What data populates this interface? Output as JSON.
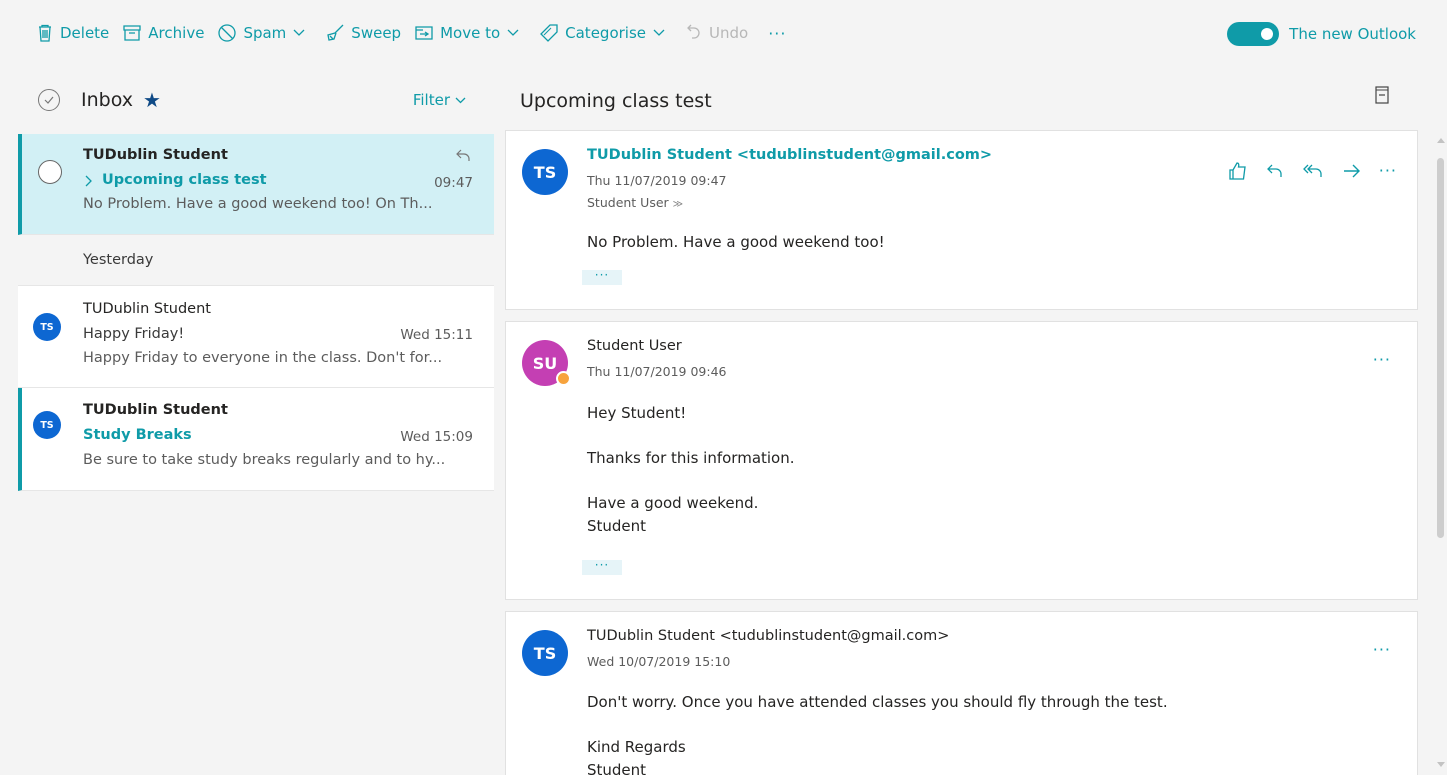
{
  "toolbar": {
    "delete": "Delete",
    "archive": "Archive",
    "spam": "Spam",
    "sweep": "Sweep",
    "move_to": "Move to",
    "categorise": "Categorise",
    "undo": "Undo",
    "more": "···",
    "new_outlook_label": "The new Outlook",
    "new_outlook_enabled": true
  },
  "list": {
    "folder_title": "Inbox",
    "favorite_icon": "star-icon",
    "filter_label": "Filter",
    "group_yesterday": "Yesterday",
    "messages": [
      {
        "sender": "TUDublin Student",
        "subject": "Upcoming class test",
        "time": "09:47",
        "preview": "No Problem. Have a good weekend too! On Th...",
        "selected": true,
        "unread": true,
        "replied": true
      },
      {
        "sender": "TUDublin Student",
        "subject": "Happy Friday!",
        "time": "Wed 15:11",
        "preview": "Happy Friday to everyone in the class. Don't for...",
        "initials": "TS",
        "unread": false
      },
      {
        "sender": "TUDublin Student",
        "subject": "Study Breaks",
        "time": "Wed 15:09",
        "preview": "Be sure to take study breaks regularly and to hy...",
        "initials": "TS",
        "unread": true
      }
    ]
  },
  "reading": {
    "title": "Upcoming class test",
    "messages": [
      {
        "initials": "TS",
        "avatar_color": "#0d67d2",
        "from": "TUDublin Student <tudublinstudent@gmail.com>",
        "date": "Thu 11/07/2019 09:47",
        "to": "Student User",
        "body": [
          "No Problem. Have a good weekend too!"
        ],
        "expand": "···",
        "more": "···"
      },
      {
        "initials": "SU",
        "avatar_color": "#c43fb3",
        "from": "Student User",
        "date": "Thu 11/07/2019 09:46",
        "body": [
          "Hey Student!",
          "Thanks for this information.",
          "Have a good weekend.",
          "Student"
        ],
        "expand": "···",
        "more": "···"
      },
      {
        "initials": "TS",
        "avatar_color": "#0d67d2",
        "from": "TUDublin Student <tudublinstudent@gmail.com>",
        "date": "Wed 10/07/2019 15:10",
        "body": [
          "Don't worry. Once you have attended classes you should fly through the test.",
          "Kind Regards",
          "Student"
        ],
        "more": "···"
      }
    ]
  },
  "colors": {
    "accent": "#0f9ba8",
    "selected_bg": "#d2f0f5",
    "avatar_blue": "#0d67d2",
    "avatar_purple": "#c43fb3"
  }
}
